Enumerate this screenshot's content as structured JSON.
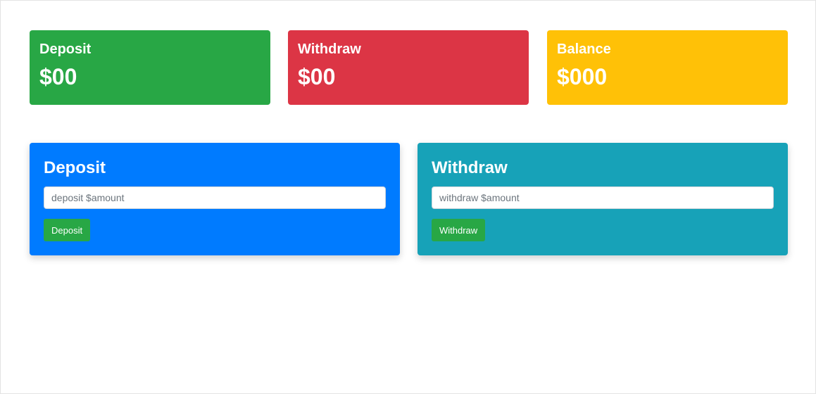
{
  "summary": {
    "deposit": {
      "title": "Deposit",
      "value": "$00",
      "color": "#28a745"
    },
    "withdraw": {
      "title": "Withdraw",
      "value": "$00",
      "color": "#dc3545"
    },
    "balance": {
      "title": "Balance",
      "value": "$000",
      "color": "#ffc107"
    }
  },
  "forms": {
    "deposit": {
      "title": "Deposit",
      "placeholder": "deposit $amount",
      "button_label": "Deposit",
      "color": "#007bff"
    },
    "withdraw": {
      "title": "Withdraw",
      "placeholder": "withdraw $amount",
      "button_label": "Withdraw",
      "color": "#17a2b8"
    }
  },
  "accent": {
    "button": "#28a745"
  }
}
